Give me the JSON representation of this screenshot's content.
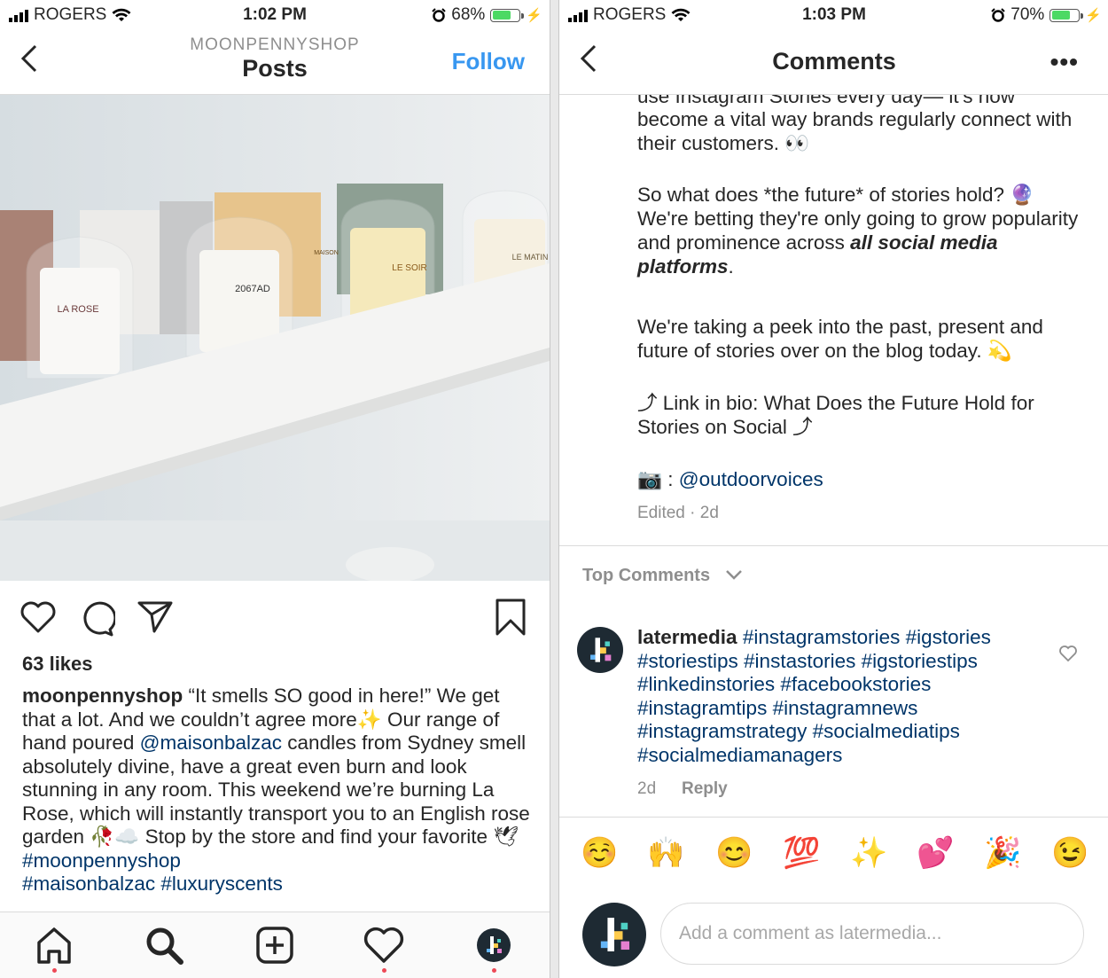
{
  "left": {
    "status": {
      "carrier": "ROGERS",
      "time": "1:02 PM",
      "battery": "68%"
    },
    "nav": {
      "kicker": "MOONPENNYSHOP",
      "title": "Posts",
      "follow": "Follow"
    },
    "photo_labels": [
      "LA ROSE",
      "2067AD",
      "LE SOIR",
      "LE MATIN",
      "MAISON"
    ],
    "likes": "63 likes",
    "caption": {
      "username": "moonpennyshop",
      "t1": " “It smells SO good in here!” We get that a lot. And we couldn’t agree more",
      "e1": "✨",
      "t2": " Our range of hand poured ",
      "mention": "@maisonbalzac",
      "t3": " candles from Sydney smell absolutely divine, have a great even burn and look stunning in any room. This weekend we’re burning La Rose, which will instantly transport you to an English rose garden ",
      "e2": "🥀",
      "e3": "☁️",
      "t4": " Stop by the store and find your favorite ",
      "e4": "🕊",
      "tag1": " #moonpennyshop",
      "tag2": "#maisonbalzac",
      "tag3": "#luxuryscents"
    },
    "tabs": [
      "home-icon",
      "search-icon",
      "new-post-icon",
      "heart-icon",
      "profile-avatar"
    ]
  },
  "right": {
    "status": {
      "carrier": "ROGERS",
      "time": "1:03 PM",
      "battery": "70%"
    },
    "nav": {
      "title": "Comments",
      "more": "•••"
    },
    "post": {
      "p0": "use Instagram Stories every day— it’s now",
      "p1": "become a vital way brands regularly connect with their customers. 👀",
      "p2a": "So what does *the future* of stories hold? 🔮 We're betting they're only going to grow popularity and prominence across ",
      "p2b": "all social media platforms",
      "p2c": ".",
      "p3": "We're taking a peek into the past, present and future of stories over on the blog today. 💫",
      "p4": "⤴ Link in bio: What Does the Future Hold for Stories on Social ⤴",
      "p5a": "📷 : ",
      "p5b": "@outdoorvoices",
      "meta": "Edited · 2d"
    },
    "top_comments": "Top Comments",
    "comment": {
      "user": "latermedia",
      "tags": " #instagramstories #igstories #storiestips #instastories #igstoriestips #linkedinstories #facebookstories #instagramtips #instagramnews #instagramstrategy #socialmediatips #socialmediamanagers",
      "time": "2d",
      "reply": "Reply"
    },
    "emojis": [
      "☺️",
      "🙌",
      "😊",
      "💯",
      "✨",
      "💕",
      "🎉",
      "😉"
    ],
    "add_placeholder": "Add a comment as latermedia..."
  },
  "colors": {
    "link": "#003569",
    "follow": "#3897f0",
    "meta": "#8e8e8e",
    "battery": "#4cd964",
    "dot": "#ed4956"
  }
}
